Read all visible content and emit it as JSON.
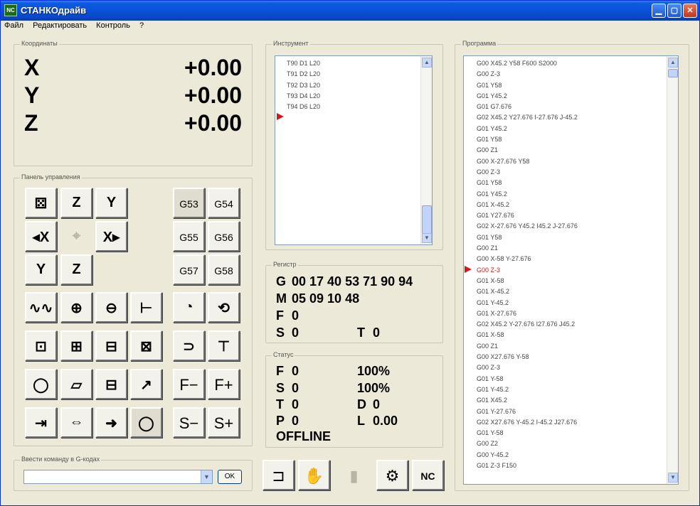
{
  "window": {
    "title": "СТАНКОдрайв",
    "icon_text": "NC"
  },
  "menu": [
    "Файл",
    "Редактировать",
    "Контроль",
    "?"
  ],
  "coordinates": {
    "label": "Координаты",
    "axes": [
      {
        "axis": "X",
        "value": "+0.00"
      },
      {
        "axis": "Y",
        "value": "+0.00"
      },
      {
        "axis": "Z",
        "value": "+0.00"
      }
    ]
  },
  "control_panel": {
    "label": "Панель управления",
    "g_buttons": [
      "G53",
      "G54",
      "G55",
      "G56",
      "G57",
      "G58"
    ],
    "f_minus": "F−",
    "f_plus": "F+",
    "s_minus": "S−",
    "s_plus": "S+"
  },
  "instruments": {
    "label": "Инструмент",
    "lines": [
      "T90 D1 L20",
      "T91 D2 L20",
      "T92 D3 L20",
      "T93 D4 L20",
      "T94 D6 L20"
    ]
  },
  "register": {
    "label": "Регистр",
    "g": "00 17 40 53 71 90 94",
    "m": "05 09 10 48",
    "f": "0",
    "s": "0",
    "t": "0"
  },
  "status": {
    "label": "Статус",
    "f": "0",
    "f_pct": "100%",
    "s": "0",
    "s_pct": "100%",
    "t": "0",
    "d": "0",
    "p": "0",
    "l": "0.00",
    "state": "OFFLINE"
  },
  "program": {
    "label": "Программа",
    "active_index": 19,
    "lines": [
      "G00 X45.2 Y58 F600 S2000",
      "G00 Z-3",
      "G01 Y58",
      "G01 Y45.2",
      "G01 G7.676",
      "G02 X45.2 Y27.676 I-27.676 J-45.2",
      "G01 Y45.2",
      "G01 Y58",
      "G00 Z1",
      "G00 X-27.676 Y58",
      "G00 Z-3",
      "G01 Y58",
      "G01 Y45.2",
      "G01 X-45.2",
      "G01 Y27.676",
      "G02 X-27.676 Y45.2 I45.2 J-27.676",
      "G01 Y58",
      "G00 Z1",
      "G00 X-58 Y-27.676",
      "G00 Z-3",
      "G01 X-58",
      "G01 X-45.2",
      "G01 Y-45.2",
      "G01 X-27.676",
      "G02 X45.2 Y-27.676 I27.676 J45.2",
      "G01 X-58",
      "G00 Z1",
      "G00 X27.676 Y-58",
      "G00 Z-3",
      "G01 Y-58",
      "G01 Y-45.2",
      "G01 X45.2",
      "G01 Y-27.676",
      "G02 X27.676 Y-45.2 I-45.2 J27.676",
      "G01 Y-58",
      "G00 Z2",
      "G00 Y-45.2",
      "G01 Z-3 F150"
    ]
  },
  "command": {
    "label": "Ввести команду в G-кодах",
    "value": "",
    "ok": "OK"
  },
  "icons": {
    "tool_change": "⚄",
    "z_home": "Z",
    "y_home": "Y",
    "x_minus": "◂X",
    "center": "⌖",
    "x_plus": "X▸",
    "y_minus": "Y",
    "z_minus": "Z",
    "spring": "∿∿",
    "drill1": "⊕",
    "drill2": "⊖",
    "drill3": "⊢",
    "probe": "◔",
    "coolant": "⟲",
    "p1": "⊡",
    "p2": "⊞",
    "p3": "⊟",
    "p4": "⊠",
    "spindle": "⊃",
    "tap": "⊤",
    "o1": "◯",
    "o2": "▱",
    "o3": "⊟",
    "o4": "↗",
    "b1": "⇥",
    "b2": "⇔",
    "b3": "➜",
    "b4": "◯",
    "run": "⊐",
    "hand": "✋",
    "stop": "▮",
    "mill": "⚙",
    "nc": "NC"
  }
}
